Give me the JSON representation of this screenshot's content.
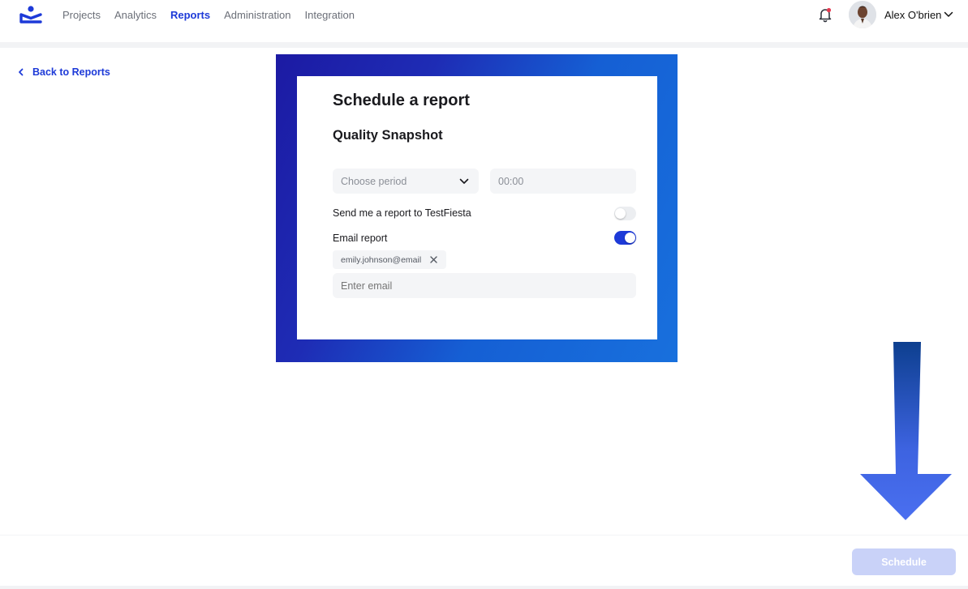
{
  "nav": {
    "items": [
      {
        "label": "Projects",
        "active": false
      },
      {
        "label": "Analytics",
        "active": false
      },
      {
        "label": "Reports",
        "active": true
      },
      {
        "label": "Administration",
        "active": false
      },
      {
        "label": "Integration",
        "active": false
      }
    ]
  },
  "user": {
    "name": "Alex O'brien"
  },
  "back": {
    "label": "Back to Reports"
  },
  "modal": {
    "title": "Schedule a report",
    "subtitle": "Quality Snapshot",
    "period_placeholder": "Choose period",
    "time_value": "00:00",
    "send_to_app_label": "Send me a report to TestFiesta",
    "send_to_app_on": false,
    "email_report_label": "Email report",
    "email_report_on": true,
    "email_chip": "emily.johnson@email",
    "email_placeholder": "Enter email"
  },
  "footer": {
    "schedule_label": "Schedule"
  },
  "colors": {
    "accent": "#1d3ad8",
    "notification_dot": "#e53950",
    "button_disabled": "#c9d2f8"
  }
}
